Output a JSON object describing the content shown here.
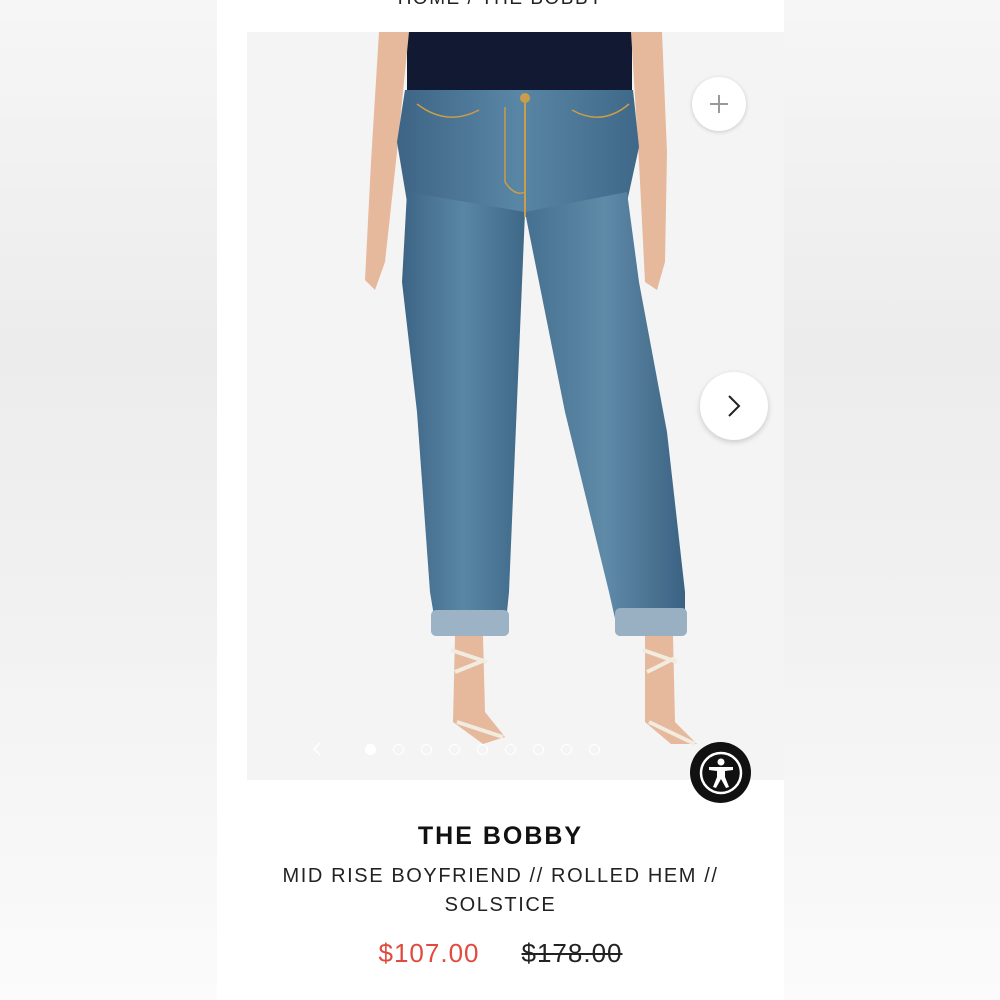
{
  "breadcrumb": {
    "home": "HOME",
    "separator": "/",
    "current": "THE BOBBY"
  },
  "gallery": {
    "total_slides": 9,
    "active_slide": 1,
    "zoom_icon": "plus-icon",
    "next_icon": "chevron-right-icon",
    "prev_icon": "chevron-left-icon"
  },
  "accessibility": {
    "icon": "accessibility-person-icon"
  },
  "product": {
    "title": "THE BOBBY",
    "subtitle": "MID RISE BOYFRIEND // ROLLED HEM // SOLSTICE",
    "sale_price": "$107.00",
    "original_price": "$178.00"
  },
  "colors": {
    "sale": "#e04a3f",
    "denim": "#4a7393",
    "accessibility_bg": "#111111"
  }
}
